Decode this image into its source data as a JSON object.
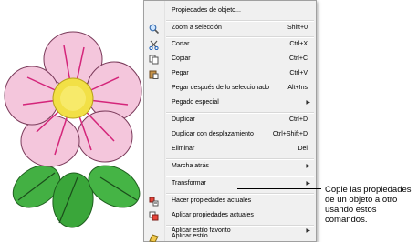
{
  "menu": {
    "items": [
      {
        "label": "Propiedades de objeto...",
        "shortcut": "",
        "submenu": false,
        "icon": ""
      },
      {
        "label": "Zoom a selección",
        "shortcut": "Shift+0",
        "submenu": false,
        "icon": "zoom-icon"
      },
      {
        "label": "Cortar",
        "shortcut": "Ctrl+X",
        "submenu": false,
        "icon": "scissors-icon"
      },
      {
        "label": "Copiar",
        "shortcut": "Ctrl+C",
        "submenu": false,
        "icon": "copy-icon"
      },
      {
        "label": "Pegar",
        "shortcut": "Ctrl+V",
        "submenu": false,
        "icon": "paste-icon"
      },
      {
        "label": "Pegar después de lo seleccionado",
        "shortcut": "Alt+Ins",
        "submenu": false,
        "icon": ""
      },
      {
        "label": "Pegado especial",
        "shortcut": "",
        "submenu": true,
        "icon": ""
      },
      {
        "label": "Duplicar",
        "shortcut": "Ctrl+D",
        "submenu": false,
        "icon": ""
      },
      {
        "label": "Duplicar con desplazamiento",
        "shortcut": "Ctrl+Shift+D",
        "submenu": false,
        "icon": ""
      },
      {
        "label": "Eliminar",
        "shortcut": "Del",
        "submenu": false,
        "icon": ""
      },
      {
        "label": "Marcha atrás",
        "shortcut": "",
        "submenu": true,
        "icon": ""
      },
      {
        "label": "Transformar",
        "shortcut": "",
        "submenu": true,
        "icon": ""
      },
      {
        "label": "Hacer propiedades actuales",
        "shortcut": "",
        "submenu": false,
        "icon": "make-current-properties-icon"
      },
      {
        "label": "Aplicar propiedades actuales",
        "shortcut": "",
        "submenu": false,
        "icon": "apply-current-properties-icon"
      },
      {
        "label": "Aplicar estilo favorito",
        "shortcut": "",
        "submenu": true,
        "icon": ""
      },
      {
        "label": "Aplicar estilo...",
        "shortcut": "",
        "submenu": false,
        "icon": "apply-style-icon"
      }
    ],
    "submenu_glyph": "▶"
  },
  "callout": {
    "text": "Copie las propiedades de un objeto a otro usando estos comandos."
  },
  "colors": {
    "petal_fill": "#f4c6dc",
    "petal_lines": "#d4257a",
    "center": "#f2e046",
    "leaf": "#3aa63a",
    "menu_bg": "#f0f0f0"
  }
}
